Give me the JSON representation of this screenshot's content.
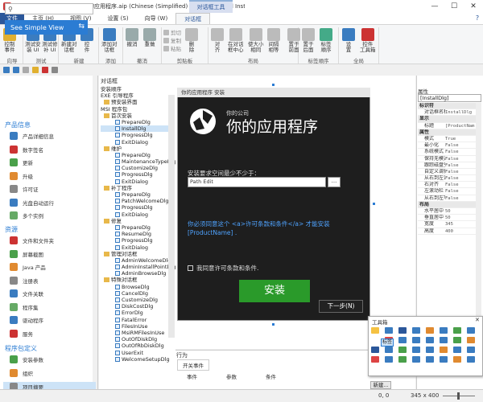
{
  "window": {
    "title": "你的应用程序 - 你的应用程序.aip (Chinese (Simplified) CN) - Advanced Inst...",
    "context_tab": "对话框工具",
    "minimize": "—",
    "maximize": "☐",
    "close": "✕"
  },
  "tabs": [
    "文件",
    "主页 (H)",
    "视图 (V)",
    "设置 (S)",
    "向导 (W)",
    "对话框"
  ],
  "ribbon": {
    "buttons": [
      {
        "label": "控制\n事件",
        "color": "#e0b030"
      },
      {
        "label": "测试安\n装 UI",
        "color": "#3a7cc0"
      },
      {
        "label": "测试修\n补 UI",
        "color": "#3a7cc0"
      },
      {
        "label": "新建对\n话框",
        "color": "#3a7cc0"
      },
      {
        "label": "控\n件",
        "color": "#3a7cc0"
      },
      {
        "label": "添加对\n话框",
        "color": "#3a7cc0"
      },
      {
        "label": "撤消",
        "color": "#9aa"
      },
      {
        "label": "重做",
        "color": "#9aa"
      },
      {
        "label": "删\n除",
        "color": "#bbb"
      },
      {
        "label": "对\n齐",
        "color": "#bbb"
      },
      {
        "label": "在对话\n框中心",
        "color": "#bbb"
      },
      {
        "label": "使大小\n相同",
        "color": "#bbb"
      },
      {
        "label": "间隔\n相等",
        "color": "#bbb"
      },
      {
        "label": "置于\n前面",
        "color": "#bbb"
      },
      {
        "label": "置于\n后面",
        "color": "#bbb"
      },
      {
        "label": "标签\n顺序",
        "color": "#4a8"
      },
      {
        "label": "设\n置",
        "color": "#3a7cc0"
      },
      {
        "label": "控件\n工具箱",
        "color": "#c33"
      }
    ],
    "small": {
      "cut": "剪切",
      "copy": "复制",
      "paste": "粘贴"
    },
    "groups": [
      "向导",
      "测试",
      "新建",
      "添加",
      "撤消",
      "剪贴板",
      "布局",
      "标签顺序",
      "全局"
    ]
  },
  "leftnav": {
    "search_placeholder": "",
    "see_view": "See Simple View",
    "sections": [
      {
        "title": "产品信息",
        "items": [
          "产品详细信息",
          "数字签名",
          "更新",
          "升级",
          "许可证",
          "光盘自动运行",
          "多个实例"
        ]
      },
      {
        "title": "资源",
        "items": [
          "文件和文件夹",
          "屏幕截图",
          "Java 产品",
          "注册表",
          "文件关联",
          "程序集",
          "驱动程序",
          "服务"
        ]
      },
      {
        "title": "程序包定义",
        "items": [
          "安装参数",
          "组织",
          "项目摘要"
        ]
      }
    ],
    "selected_item": "项目摘要"
  },
  "tree": {
    "title": "对话框",
    "rows": [
      {
        "t": "安装顺序",
        "k": "h"
      },
      {
        "t": "EXE 引导程序",
        "k": "h"
      },
      {
        "t": "预安装界面",
        "k": "f"
      },
      {
        "t": "MSI 程序包",
        "k": "h"
      },
      {
        "t": "首次安装",
        "k": "f"
      },
      {
        "t": "PrepareDlg",
        "k": "d"
      },
      {
        "t": "InstallDlg",
        "k": "d",
        "sel": true
      },
      {
        "t": "ProgressDlg",
        "k": "d"
      },
      {
        "t": "ExitDialog",
        "k": "d"
      },
      {
        "t": "维护",
        "k": "f"
      },
      {
        "t": "PrepareDlg",
        "k": "d"
      },
      {
        "t": "MaintenanceTypeDlg",
        "k": "d"
      },
      {
        "t": "CustomizeDlg",
        "k": "d"
      },
      {
        "t": "ProgressDlg",
        "k": "d"
      },
      {
        "t": "ExitDialog",
        "k": "d"
      },
      {
        "t": "补丁程序",
        "k": "f"
      },
      {
        "t": "PrepareDlg",
        "k": "d"
      },
      {
        "t": "PatchWelcomeDlg",
        "k": "d"
      },
      {
        "t": "ProgressDlg",
        "k": "d"
      },
      {
        "t": "ExitDialog",
        "k": "d"
      },
      {
        "t": "修复",
        "k": "f"
      },
      {
        "t": "PrepareDlg",
        "k": "d"
      },
      {
        "t": "ResumeDlg",
        "k": "d"
      },
      {
        "t": "ProgressDlg",
        "k": "d"
      },
      {
        "t": "ExitDialog",
        "k": "d"
      },
      {
        "t": "管理对话框",
        "k": "f"
      },
      {
        "t": "AdminWelcomeDlg",
        "k": "d"
      },
      {
        "t": "AdminInstallPointDlg",
        "k": "d"
      },
      {
        "t": "AdminBrowseDlg",
        "k": "d"
      },
      {
        "t": "特殊对话框",
        "k": "f"
      },
      {
        "t": "BrowseDlg",
        "k": "d"
      },
      {
        "t": "CancelDlg",
        "k": "d"
      },
      {
        "t": "CustomizeDlg",
        "k": "d"
      },
      {
        "t": "DiskCostDlg",
        "k": "d"
      },
      {
        "t": "ErrorDlg",
        "k": "d"
      },
      {
        "t": "FatalError",
        "k": "d"
      },
      {
        "t": "FilesInUse",
        "k": "d"
      },
      {
        "t": "MsiRMFilesInUse",
        "k": "d"
      },
      {
        "t": "OutOfDiskDlg",
        "k": "d"
      },
      {
        "t": "OutOfRbDiskDlg",
        "k": "d"
      },
      {
        "t": "UserExit",
        "k": "d"
      },
      {
        "t": "WelcomeSetupDlg",
        "k": "d"
      }
    ]
  },
  "dialog": {
    "window_title": "你的应用程序 安装",
    "company": "你的公司",
    "app": "你的应用程序",
    "space": "安装要求空间最少不少于：",
    "path": "Path Edit",
    "browse": "...",
    "license": "你必须同意这个 <a>许可条款和条件</a> 才能安装 [ProductName] .",
    "agree": "我同意许可条款和条件.",
    "install": "安装",
    "next": "下一步(N)"
  },
  "props": {
    "title": "属性",
    "combo": "[InstallDlg]",
    "rows": [
      {
        "k": "标识符",
        "v": "",
        "cat": true
      },
      {
        "k": "对话框名称",
        "v": "InstallDlg"
      },
      {
        "k": "显示",
        "v": "",
        "cat": true
      },
      {
        "k": "标题",
        "v": "[ProductNam"
      },
      {
        "k": "属性",
        "v": "",
        "cat": true
      },
      {
        "k": "模式",
        "v": "True"
      },
      {
        "k": "最小化",
        "v": "False"
      },
      {
        "k": "系统模式",
        "v": "False"
      },
      {
        "k": "保持无模式",
        "v": "False"
      },
      {
        "k": "跟踪磁盘空间",
        "v": "False"
      },
      {
        "k": "自定义调色板",
        "v": "False"
      },
      {
        "k": "从右到左读取",
        "v": "False"
      },
      {
        "k": "右对齐",
        "v": "False"
      },
      {
        "k": "左滚动栏",
        "v": "False"
      },
      {
        "k": "从右到左写",
        "v": "False"
      },
      {
        "k": "布局",
        "v": "",
        "cat": true
      },
      {
        "k": "水平居中",
        "v": "50"
      },
      {
        "k": "垂直居中",
        "v": "50"
      },
      {
        "k": "宽度",
        "v": "345"
      },
      {
        "k": "高度",
        "v": "400"
      }
    ]
  },
  "output": {
    "title": "行为",
    "tab": "开关事件",
    "headers": [
      "事件",
      "参数",
      "条件"
    ]
  },
  "toolbox": {
    "title": "工具箱",
    "selected": "标签",
    "close": "✕",
    "icons": [
      "#f5c242",
      "#3a7cc0",
      "#2b579a",
      "#3a7cc0",
      "#e08a30",
      "#3a7cc0",
      "#4aa04a",
      "#3a7cc0",
      "#3a7cc0",
      "#d44",
      "#3a7cc0",
      "#3a7cc0",
      "#3a7cc0",
      "#3a7cc0",
      "#4aa04a",
      "#e08a30",
      "#2b579a",
      "#3a7cc0",
      "#4aa04a",
      "#3a7cc0",
      "#3a7cc0",
      "#e08a30",
      "#3a7cc0",
      "#3a7cc0",
      "#d44",
      "#3a7cc0",
      "#4aa04a",
      "#3a7cc0",
      "#3a7cc0",
      "#3a7cc0",
      "#e08a30",
      "#3a7cc0"
    ]
  },
  "next_btn": "新建...",
  "status": {
    "coords": "0, 0",
    "size": "345 x 400"
  }
}
